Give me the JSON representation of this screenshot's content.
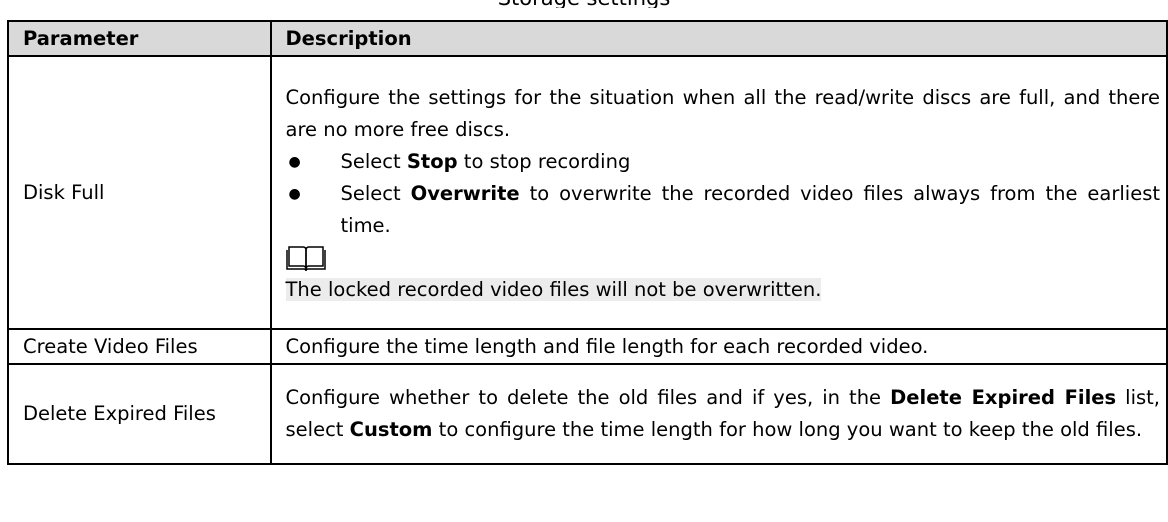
{
  "caption": "Storage settings",
  "headers": {
    "param": "Parameter",
    "desc": "Description"
  },
  "rows": [
    {
      "param": "Disk Full",
      "desc": {
        "intro": "Configure the settings for the situation when all the read/write discs are full, and there are no more free discs.",
        "bullets": [
          {
            "pre": "Select ",
            "bold": "Stop",
            "post": " to stop recording"
          },
          {
            "pre": "Select ",
            "bold": "Overwrite",
            "post": " to overwrite the recorded video files always from the earliest time."
          }
        ],
        "note_icon": "book-note-icon",
        "note": "The locked recorded video files will not be overwritten."
      }
    },
    {
      "param": "Create Video Files",
      "desc": {
        "text": "Configure the time length and file length for each recorded video."
      }
    },
    {
      "param": "Delete Expired Files",
      "desc": {
        "p1": "Configure whether to delete the old files and if yes, in the ",
        "b1": "Delete Expired Files",
        "p2": " list, select ",
        "b2": "Custom",
        "p3": " to configure the time length for how long you want to keep the old files."
      }
    }
  ]
}
